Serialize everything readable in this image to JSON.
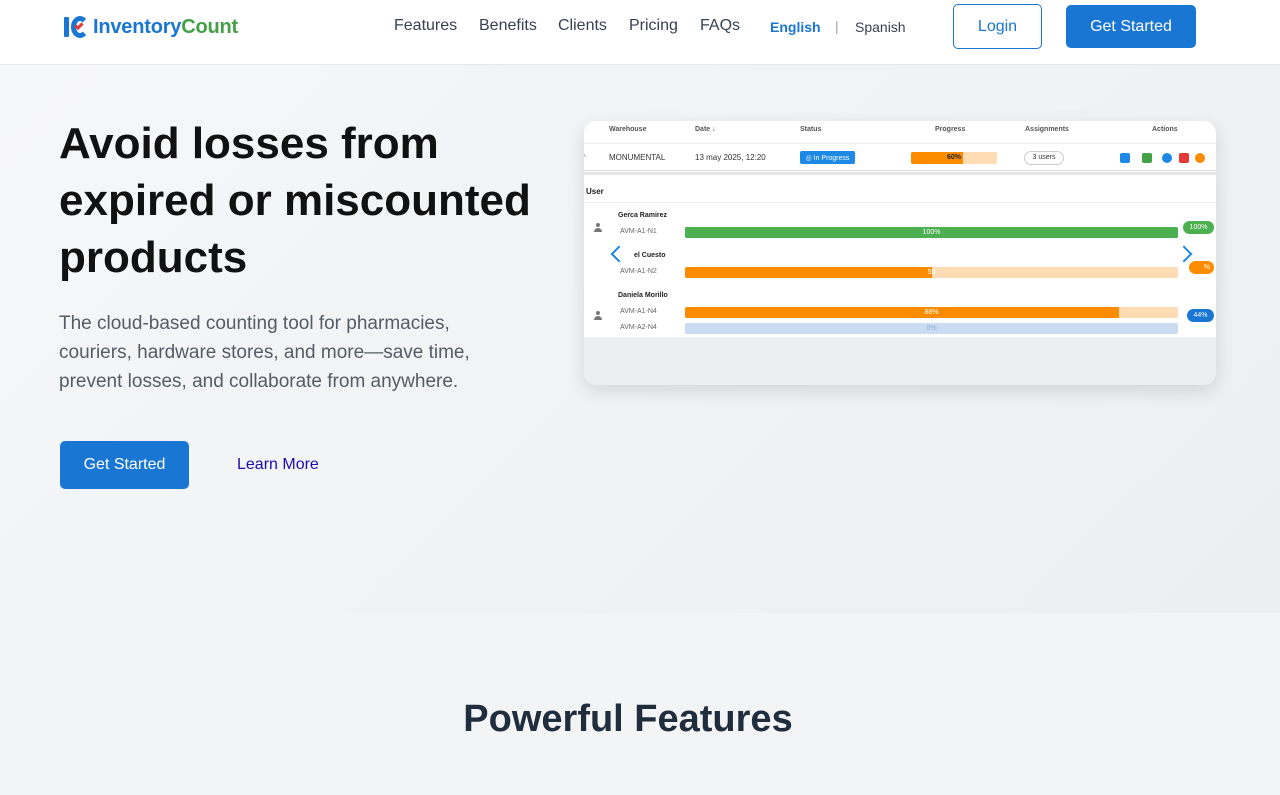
{
  "header": {
    "logo": {
      "part1": "Inventory",
      "part2": "Count"
    },
    "nav": [
      "Features",
      "Benefits",
      "Clients",
      "Pricing",
      "FAQs"
    ],
    "languages": {
      "english": "English",
      "separator": "|",
      "spanish": "Spanish"
    },
    "login_label": "Login",
    "get_started_label": "Get Started"
  },
  "hero": {
    "title": "Avoid losses from expired or miscounted products",
    "subtitle": "The cloud-based counting tool for pharmacies, couriers, hardware stores, and more—save time, prevent losses, and collaborate from anywhere.",
    "cta_primary": "Get Started",
    "cta_secondary": "Learn More"
  },
  "carousel": {
    "table_headers": {
      "warehouse": "Warehouse",
      "date": "Date ↓",
      "status": "Status",
      "progress": "Progress",
      "assignments": "Assignments",
      "actions": "Actions"
    },
    "row": {
      "caret": "^",
      "warehouse": "MONUMENTAL",
      "date": "13 may 2025, 12:20",
      "status": "◎ In Progress",
      "progress_label": "60%",
      "progress_value": 0.6,
      "assignments": "3 users"
    },
    "user_header": "User",
    "users": [
      {
        "name": "Gerca Ramirez",
        "code": "AVM-A1-N1",
        "progress_label": "100%",
        "progress_value": 1.0,
        "badge": "100%"
      },
      {
        "name": "el Cuesto",
        "code": "AVM-A1-N2",
        "progress_label": "50",
        "progress_value": 0.5,
        "badge": "%"
      },
      {
        "name": "Daniela Morillo",
        "code": "AVM-A1-N4",
        "progress_label": "88%",
        "progress_value": 0.88,
        "badge": "44%"
      }
    ],
    "extra_code": "AVM-A2-N4",
    "extra_progress_label": "0%",
    "dot_count": 5,
    "active_dot": 1,
    "colors": {
      "green": "#4caf50",
      "orange": "#fb8c00",
      "orange_light": "#ffdcb3",
      "blue": "#1976d2",
      "blue_light": "#c9dcf2"
    }
  },
  "features": {
    "title": "Powerful Features"
  }
}
